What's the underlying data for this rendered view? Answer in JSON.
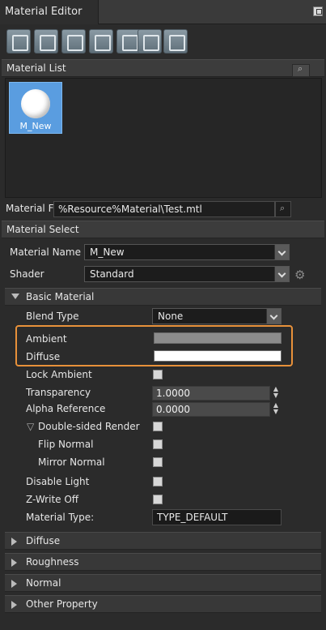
{
  "window": {
    "tab_title": "Material Editor"
  },
  "toolbar": {
    "icons": [
      "new-material-icon",
      "eyedropper-icon",
      "reset-icon",
      "save-icon",
      "save-as-icon",
      "open-folder-icon",
      "assign-icon"
    ]
  },
  "material_list": {
    "header": "Material List",
    "items": [
      {
        "name": "M_New"
      }
    ]
  },
  "material_file": {
    "label": "Material F",
    "value": "%Resource%Material\\Test.mtl"
  },
  "material_select": {
    "header": "Material Select",
    "name_label": "Material Name",
    "name_value": "M_New",
    "shader_label": "Shader",
    "shader_value": "Standard"
  },
  "basic_material": {
    "header": "Basic Material",
    "blend_type_label": "Blend Type",
    "blend_type_value": "None",
    "ambient_label": "Ambient",
    "ambient_color": "#8c8c8c",
    "diffuse_label": "Diffuse",
    "diffuse_color": "#ffffff",
    "lock_ambient_label": "Lock Ambient",
    "transparency_label": "Transparency",
    "transparency_value": "1.0000",
    "alpha_reference_label": "Alpha Reference",
    "alpha_reference_value": "0.0000",
    "double_sided_label": "Double-sided Render",
    "flip_normal_label": "Flip Normal",
    "mirror_normal_label": "Mirror Normal",
    "disable_light_label": "Disable Light",
    "zwrite_off_label": "Z-Write Off",
    "material_type_label": "Material Type:",
    "material_type_value": "TYPE_DEFAULT"
  },
  "collapsed_groups": {
    "diffuse": "Diffuse",
    "roughness": "Roughness",
    "normal": "Normal",
    "other": "Other Property"
  },
  "colors": {
    "highlight": "#e8913a",
    "selection": "#5a9de0"
  }
}
